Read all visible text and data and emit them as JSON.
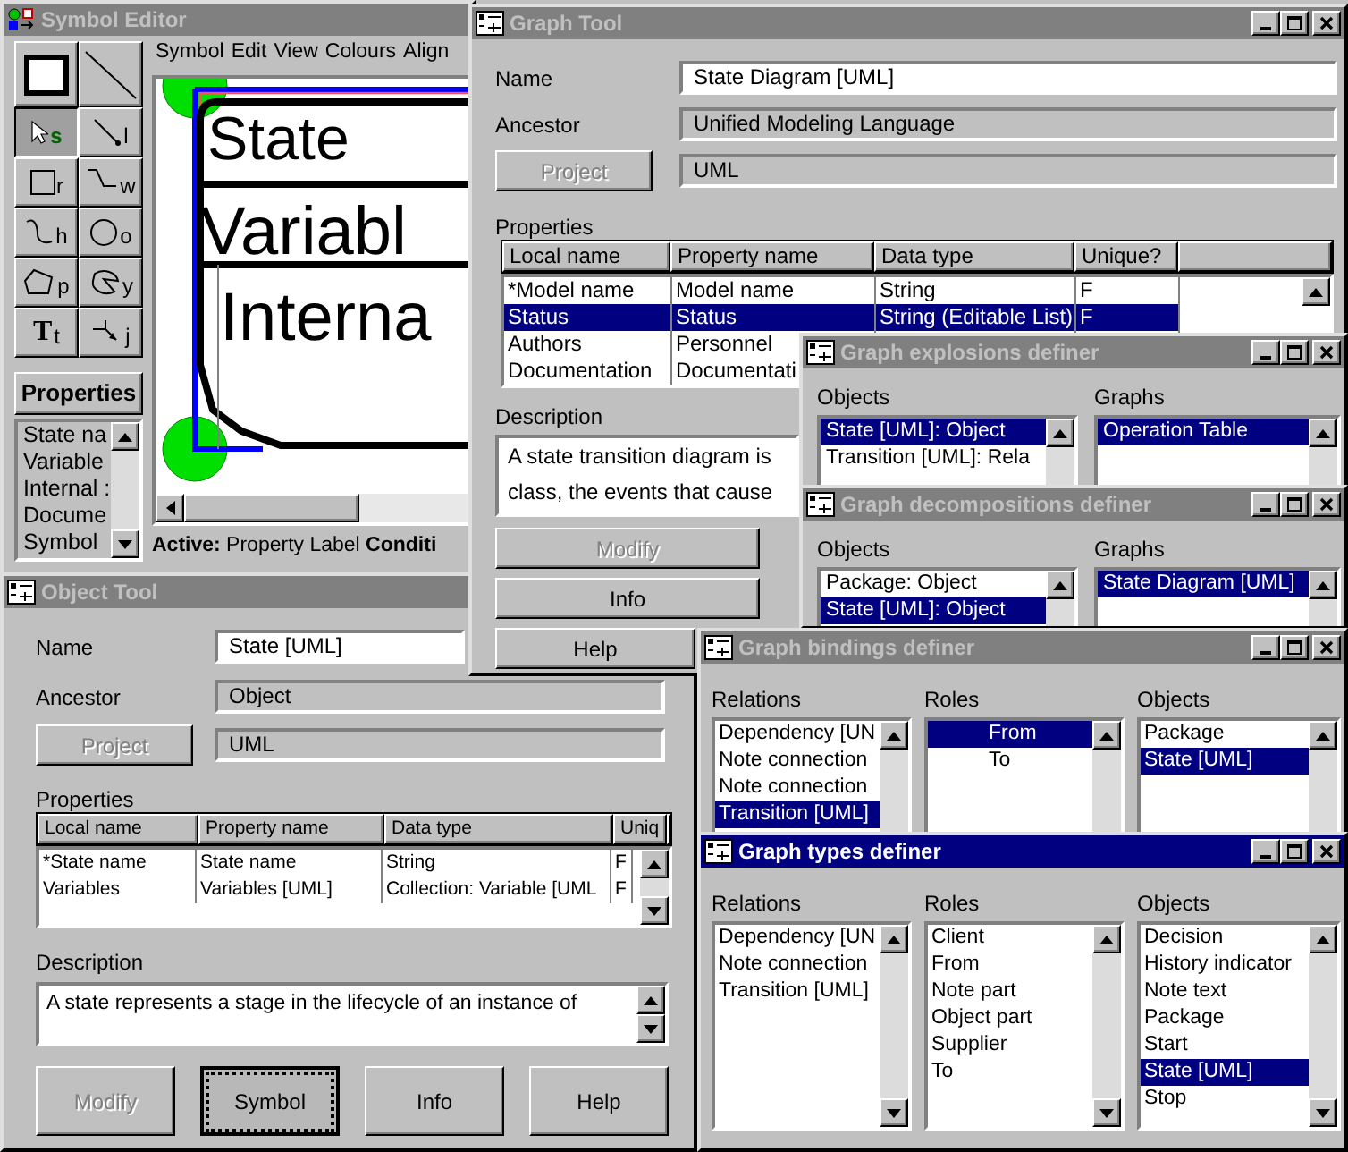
{
  "symbol_editor": {
    "title": "Symbol Editor",
    "active": false,
    "menu": [
      "Symbol",
      "Edit",
      "View",
      "Colours",
      "Align"
    ],
    "tools": [
      {
        "kind": "frame",
        "selected": false
      },
      {
        "kind": "line",
        "selected": false
      },
      {
        "kind": "pointer",
        "key": "s",
        "selected": true
      },
      {
        "kind": "segment",
        "key": "l",
        "selected": false
      },
      {
        "kind": "square",
        "key": "r",
        "selected": false
      },
      {
        "kind": "step",
        "key": "w",
        "selected": false
      },
      {
        "kind": "curve",
        "key": "h",
        "selected": false
      },
      {
        "kind": "oval",
        "key": "o",
        "selected": false
      },
      {
        "kind": "polygon",
        "key": "p",
        "selected": false
      },
      {
        "kind": "blob",
        "key": "y",
        "selected": false
      },
      {
        "kind": "glyph",
        "glyph": "T",
        "key": "t",
        "selected": false
      },
      {
        "kind": "connector",
        "key": "j",
        "selected": false
      }
    ],
    "properties_title": "Properties",
    "properties": [
      "State na",
      "Variable",
      "Internal :",
      "Docume",
      "Symbol"
    ],
    "canvas_labels": [
      "State",
      "Variabl",
      "Interna"
    ],
    "status": "**Active:** Property Label **Conditi**"
  },
  "graph_tool": {
    "title": "Graph Tool",
    "active": false,
    "name_label": "Name",
    "name": "State Diagram [UML]",
    "ancestor_label": "Ancestor",
    "ancestor": "Unified Modeling Language",
    "project_button": {
      "label": "Project",
      "disabled": true
    },
    "project": "UML",
    "properties_label": "Properties",
    "columns": [
      "Local name",
      "Property name",
      "Data type",
      "Unique?"
    ],
    "rows": [
      {
        "cells": [
          "*Model name",
          "Model name",
          "String",
          "F"
        ],
        "selected": false
      },
      {
        "cells": [
          "Status",
          "Status",
          "String (Editable List)",
          "F"
        ],
        "selected": true
      },
      {
        "cells": [
          "Authors",
          "Personnel"
        ],
        "selected": false
      },
      {
        "cells": [
          "Documentation",
          "Documentati"
        ],
        "selected": false
      }
    ],
    "description_label": "Description",
    "description": [
      "A state transition diagram is",
      "class, the events that cause"
    ],
    "buttons": [
      {
        "label": "Modify",
        "disabled": true,
        "focused": false
      },
      {
        "label": "Info",
        "disabled": false,
        "focused": false
      },
      {
        "label": "Help",
        "disabled": false,
        "focused": false
      }
    ]
  },
  "object_tool": {
    "title": "Object Tool",
    "active": false,
    "name_label": "Name",
    "name": "State [UML]",
    "ancestor_label": "Ancestor",
    "ancestor": "Object",
    "project_button": {
      "label": "Project",
      "disabled": true
    },
    "project": "UML",
    "properties_label": "Properties",
    "columns": [
      "Local name",
      "Property name",
      "Data type",
      "Uniq"
    ],
    "rows": [
      {
        "cells": [
          "*State name",
          "State name",
          "String",
          "F"
        ],
        "selected": false
      },
      {
        "cells": [
          "Variables",
          "Variables [UML]",
          "Collection: Variable [UML",
          "F"
        ],
        "selected": false
      }
    ],
    "description_label": "Description",
    "description": [
      "A state represents a stage in the lifecycle of an instance of"
    ],
    "buttons": [
      {
        "label": "Modify",
        "disabled": true,
        "focused": false
      },
      {
        "label": "Symbol",
        "disabled": false,
        "focused": true
      },
      {
        "label": "Info",
        "disabled": false,
        "focused": false
      },
      {
        "label": "Help",
        "disabled": false,
        "focused": false
      }
    ]
  },
  "graph_explosions_definer": {
    "title": "Graph explosions definer",
    "active": false,
    "lists": [
      {
        "label": "Objects",
        "items": [
          {
            "label": "State [UML]: Object",
            "selected": true
          },
          {
            "label": "Transition [UML]: Rela",
            "selected": false
          }
        ]
      },
      {
        "label": "Graphs",
        "items": [
          {
            "label": "Operation Table",
            "selected": true
          }
        ]
      }
    ]
  },
  "graph_decompositions_definer": {
    "title": "Graph decompositions definer",
    "active": false,
    "lists": [
      {
        "label": "Objects",
        "items": [
          {
            "label": "Package: Object",
            "selected": false
          },
          {
            "label": "State [UML]: Object",
            "selected": true
          }
        ]
      },
      {
        "label": "Graphs",
        "items": [
          {
            "label": "State Diagram [UML]",
            "selected": true
          }
        ]
      }
    ]
  },
  "graph_bindings_definer": {
    "title": "Graph bindings definer",
    "active": false,
    "lists": [
      {
        "label": "Relations",
        "items": [
          {
            "label": "Dependency [UN",
            "selected": false
          },
          {
            "label": "Note connection",
            "selected": false
          },
          {
            "label": "Note connection",
            "selected": false
          },
          {
            "label": "Transition [UML]",
            "selected": true
          }
        ]
      },
      {
        "label": "Roles",
        "items": [
          {
            "label": "From",
            "selected": true
          },
          {
            "label": "To",
            "selected": false
          }
        ]
      },
      {
        "label": "Objects",
        "items": [
          {
            "label": "Package",
            "selected": false
          },
          {
            "label": "State [UML]",
            "selected": true
          }
        ]
      }
    ]
  },
  "graph_types_definer": {
    "title": "Graph types definer",
    "active": true,
    "lists": [
      {
        "label": "Relations",
        "items": [
          {
            "label": "Dependency [UN",
            "selected": false
          },
          {
            "label": "Note connection",
            "selected": false
          },
          {
            "label": "Transition [UML]",
            "selected": false
          }
        ]
      },
      {
        "label": "Roles",
        "items": [
          {
            "label": "Client",
            "selected": false
          },
          {
            "label": "From",
            "selected": false
          },
          {
            "label": "Note part",
            "selected": false
          },
          {
            "label": "Object part",
            "selected": false
          },
          {
            "label": "Supplier",
            "selected": false
          },
          {
            "label": "To",
            "selected": false
          }
        ]
      },
      {
        "label": "Objects",
        "items": [
          {
            "label": "Decision",
            "selected": false
          },
          {
            "label": "History indicator",
            "selected": false
          },
          {
            "label": "Note text",
            "selected": false
          },
          {
            "label": "Package",
            "selected": false
          },
          {
            "label": "Start",
            "selected": false
          },
          {
            "label": "State [UML]",
            "selected": true
          },
          {
            "label": "Stop",
            "selected": false
          }
        ]
      }
    ]
  }
}
